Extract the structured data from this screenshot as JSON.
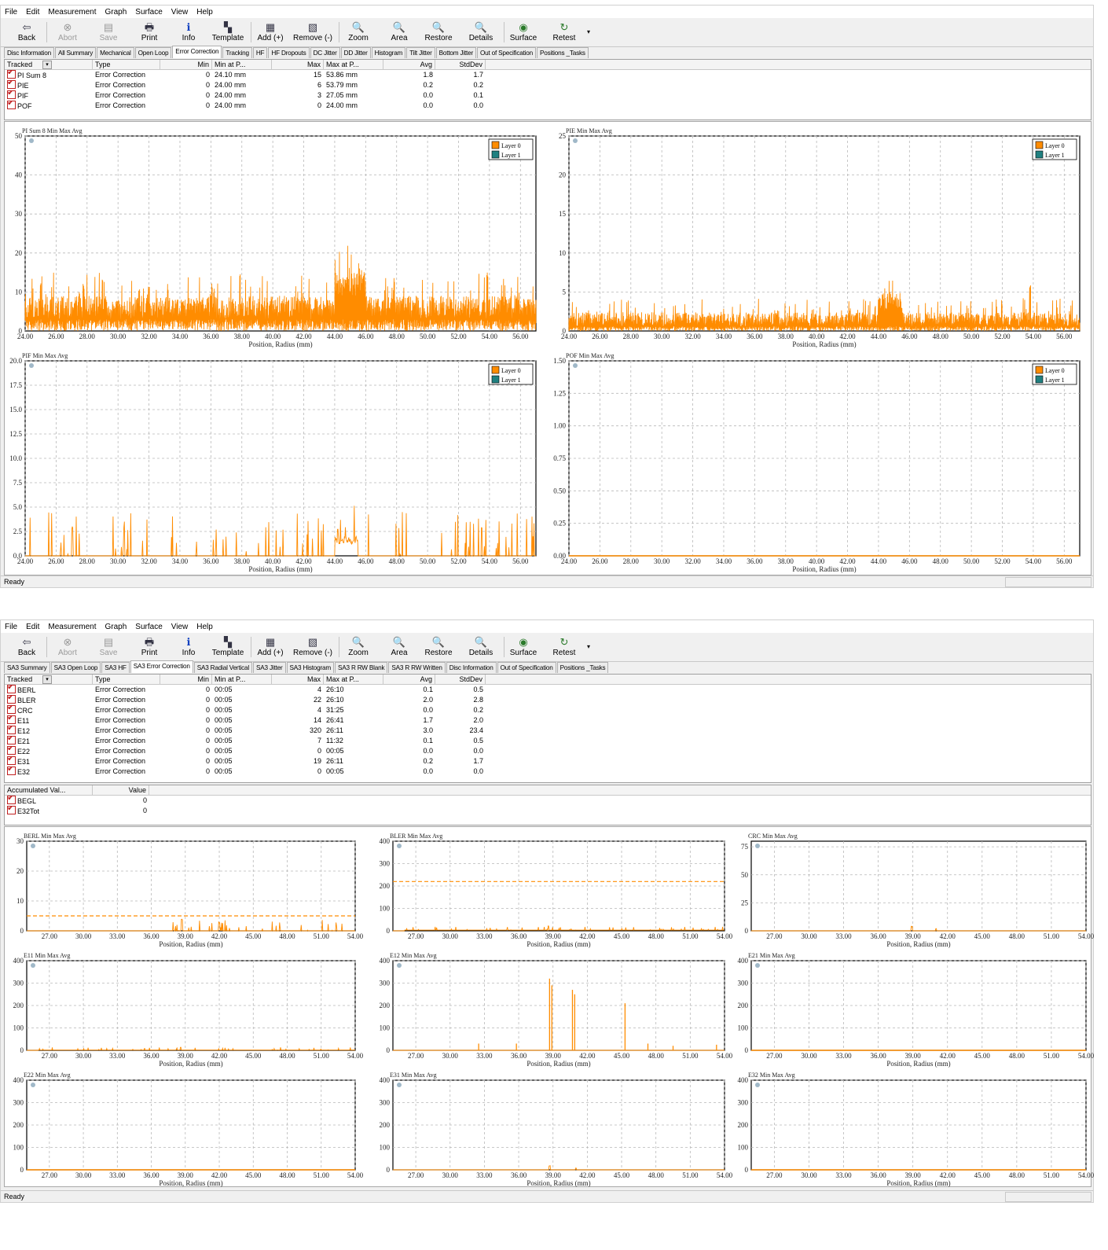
{
  "colors": {
    "layer0": "#ff8c00",
    "layer1": "#208080",
    "grid": "#b8b8b8",
    "red": "#c02020"
  },
  "windows": [
    {
      "menu": [
        "File",
        "Edit",
        "Measurement",
        "Graph",
        "Surface",
        "View",
        "Help"
      ],
      "toolbar": [
        {
          "label": "Back",
          "icon": "back-icon",
          "glyph": "⇦",
          "disabled": false
        },
        {
          "label": "Abort",
          "icon": "abort-icon",
          "glyph": "⊗",
          "disabled": true
        },
        {
          "label": "Save",
          "icon": "save-icon",
          "glyph": "▤",
          "disabled": true
        },
        {
          "label": "Print",
          "icon": "print-icon",
          "glyph": "🖶",
          "disabled": false
        },
        {
          "label": "Info",
          "icon": "info-icon",
          "glyph": "ℹ",
          "disabled": false
        },
        {
          "label": "Template",
          "icon": "template-icon",
          "glyph": "▚",
          "disabled": false
        },
        {
          "label": "Add (+)",
          "icon": "add-icon",
          "glyph": "▦",
          "disabled": false
        },
        {
          "label": "Remove (-)",
          "icon": "remove-icon",
          "glyph": "▧",
          "disabled": false
        },
        {
          "label": "Zoom",
          "icon": "zoom-icon",
          "glyph": "🔍",
          "disabled": false
        },
        {
          "label": "Area",
          "icon": "area-icon",
          "glyph": "🔍",
          "disabled": false
        },
        {
          "label": "Restore",
          "icon": "restore-icon",
          "glyph": "🔍",
          "disabled": false
        },
        {
          "label": "Details",
          "icon": "details-icon",
          "glyph": "🔍",
          "disabled": false
        },
        {
          "label": "Surface",
          "icon": "surface-icon",
          "glyph": "◉",
          "disabled": false
        },
        {
          "label": "Retest",
          "icon": "retest-icon",
          "glyph": "↻",
          "disabled": false
        }
      ],
      "tabs": [
        "Disc Information",
        "All Summary",
        "Mechanical",
        "Open Loop",
        "Error Correction",
        "Tracking",
        "HF",
        "HF Dropouts",
        "DC Jitter",
        "DD Jitter",
        "Histogram",
        "Tilt Jitter",
        "Bottom Jitter",
        "Out of Specification",
        "Positions _Tasks"
      ],
      "active_tab": "Error Correction",
      "table": {
        "headers": [
          "Tracked",
          "Type",
          "Min",
          "Min at P...",
          "Max",
          "Max at P...",
          "Avg",
          "StdDev"
        ],
        "rows": [
          [
            "PI Sum 8",
            "Error Correction",
            "0",
            "24.10 mm",
            "15",
            "53.86 mm",
            "1.8",
            "1.7"
          ],
          [
            "PIE",
            "Error Correction",
            "0",
            "24.00 mm",
            "6",
            "53.79 mm",
            "0.2",
            "0.2"
          ],
          [
            "PIF",
            "Error Correction",
            "0",
            "24.00 mm",
            "3",
            "27.05 mm",
            "0.0",
            "0.1"
          ],
          [
            "POF",
            "Error Correction",
            "0",
            "24.00 mm",
            "0",
            "24.00 mm",
            "0.0",
            "0.0"
          ]
        ]
      },
      "status": "Ready"
    },
    {
      "menu": [
        "File",
        "Edit",
        "Measurement",
        "Graph",
        "Surface",
        "View",
        "Help"
      ],
      "toolbar": [
        {
          "label": "Back",
          "icon": "back-icon",
          "glyph": "⇦",
          "disabled": false
        },
        {
          "label": "Abort",
          "icon": "abort-icon",
          "glyph": "⊗",
          "disabled": true
        },
        {
          "label": "Save",
          "icon": "save-icon",
          "glyph": "▤",
          "disabled": true
        },
        {
          "label": "Print",
          "icon": "print-icon",
          "glyph": "🖶",
          "disabled": false
        },
        {
          "label": "Info",
          "icon": "info-icon",
          "glyph": "ℹ",
          "disabled": false
        },
        {
          "label": "Template",
          "icon": "template-icon",
          "glyph": "▚",
          "disabled": false
        },
        {
          "label": "Add (+)",
          "icon": "add-icon",
          "glyph": "▦",
          "disabled": false
        },
        {
          "label": "Remove (-)",
          "icon": "remove-icon",
          "glyph": "▧",
          "disabled": false
        },
        {
          "label": "Zoom",
          "icon": "zoom-icon",
          "glyph": "🔍",
          "disabled": false
        },
        {
          "label": "Area",
          "icon": "area-icon",
          "glyph": "🔍",
          "disabled": false
        },
        {
          "label": "Restore",
          "icon": "restore-icon",
          "glyph": "🔍",
          "disabled": false
        },
        {
          "label": "Details",
          "icon": "details-icon",
          "glyph": "🔍",
          "disabled": false
        },
        {
          "label": "Surface",
          "icon": "surface-icon",
          "glyph": "◉",
          "disabled": false
        },
        {
          "label": "Retest",
          "icon": "retest-icon",
          "glyph": "↻",
          "disabled": false
        }
      ],
      "tabs": [
        "SA3 Summary",
        "SA3 Open Loop",
        "SA3 HF",
        "SA3 Error Correction",
        "SA3 Radial Vertical",
        "SA3 Jitter",
        "SA3 Histogram",
        "SA3 R RW Blank",
        "SA3 R RW Written",
        "Disc Information",
        "Out of Specification",
        "Positions _Tasks"
      ],
      "active_tab": "SA3 Error Correction",
      "table": {
        "headers": [
          "Tracked",
          "Type",
          "Min",
          "Min at P...",
          "Max",
          "Max at P...",
          "Avg",
          "StdDev"
        ],
        "rows": [
          [
            "BERL",
            "Error Correction",
            "0",
            "00:05",
            "4",
            "26:10",
            "0.1",
            "0.5"
          ],
          [
            "BLER",
            "Error Correction",
            "0",
            "00:05",
            "22",
            "26:10",
            "2.0",
            "2.8"
          ],
          [
            "CRC",
            "Error Correction",
            "0",
            "00:05",
            "4",
            "31:25",
            "0.0",
            "0.2"
          ],
          [
            "E11",
            "Error Correction",
            "0",
            "00:05",
            "14",
            "26:41",
            "1.7",
            "2.0"
          ],
          [
            "E12",
            "Error Correction",
            "0",
            "00:05",
            "320",
            "26:11",
            "3.0",
            "23.4"
          ],
          [
            "E21",
            "Error Correction",
            "0",
            "00:05",
            "7",
            "11:32",
            "0.1",
            "0.5"
          ],
          [
            "E22",
            "Error Correction",
            "0",
            "00:05",
            "0",
            "00:05",
            "0.0",
            "0.0"
          ],
          [
            "E31",
            "Error Correction",
            "0",
            "00:05",
            "19",
            "26:11",
            "0.2",
            "1.7"
          ],
          [
            "E32",
            "Error Correction",
            "0",
            "00:05",
            "0",
            "00:05",
            "0.0",
            "0.0"
          ]
        ]
      },
      "accum": {
        "headers": [
          "Accumulated Val...",
          "Value"
        ],
        "rows": [
          [
            "BEGL",
            "0"
          ],
          [
            "E32Tot",
            "0"
          ]
        ]
      },
      "status": "Ready"
    }
  ],
  "chart_data": [
    {
      "type": "line",
      "title": "PI Sum 8 Min Max Avg",
      "xlabel": "Position, Radius (mm)",
      "xlim": [
        24,
        57
      ],
      "ylim": [
        0,
        50
      ],
      "xticks": [
        "24.00",
        "26.00",
        "28.00",
        "30.00",
        "32.00",
        "34.00",
        "36.00",
        "38.00",
        "40.00",
        "42.00",
        "44.00",
        "46.00",
        "48.00",
        "50.00",
        "52.00",
        "54.00",
        "56.00"
      ],
      "yticks": [
        "0",
        "10",
        "20",
        "30",
        "40",
        "50"
      ],
      "legend": [
        "Layer 0",
        "Layer 1"
      ],
      "legend_position": "top-right",
      "series": [
        {
          "name": "Layer 0",
          "base": 3,
          "noise": 6,
          "peaks": [
            [
              25,
              13
            ],
            [
              27.5,
              10
            ],
            [
              29,
              14
            ],
            [
              32,
              12
            ],
            [
              36,
              10
            ],
            [
              38.5,
              9
            ],
            [
              45,
              11
            ],
            [
              53.86,
              15
            ]
          ],
          "bump": [
            44,
            46,
            8
          ]
        }
      ]
    },
    {
      "type": "line",
      "title": "PIE Min Max Avg",
      "xlabel": "Position, Radius (mm)",
      "xlim": [
        24,
        57
      ],
      "ylim": [
        0,
        25
      ],
      "xticks": [
        "24.00",
        "26.00",
        "28.00",
        "30.00",
        "32.00",
        "34.00",
        "36.00",
        "38.00",
        "40.00",
        "42.00",
        "44.00",
        "46.00",
        "48.00",
        "50.00",
        "52.00",
        "54.00",
        "56.00"
      ],
      "yticks": [
        "0",
        "5",
        "10",
        "15",
        "20",
        "25"
      ],
      "legend": [
        "Layer 0",
        "Layer 1"
      ],
      "legend_position": "top-right",
      "series": [
        {
          "name": "Layer 0",
          "base": 0.6,
          "noise": 1.8,
          "peaks": [
            [
              53.79,
              6
            ],
            [
              44.5,
              3
            ],
            [
              45.5,
              3
            ]
          ],
          "bump": [
            44,
            45.5,
            3
          ]
        }
      ]
    },
    {
      "type": "line",
      "title": "PIF Min Max Avg",
      "xlabel": "Position, Radius (mm)",
      "xlim": [
        24,
        57
      ],
      "ylim": [
        0,
        20
      ],
      "xticks": [
        "24.00",
        "26.00",
        "28.00",
        "30.00",
        "32.00",
        "34.00",
        "36.00",
        "38.00",
        "40.00",
        "42.00",
        "44.00",
        "46.00",
        "48.00",
        "50.00",
        "52.00",
        "54.00",
        "56.00"
      ],
      "yticks": [
        "0.0",
        "2.5",
        "5.0",
        "7.5",
        "10.0",
        "12.5",
        "15.0",
        "17.5",
        "20.0"
      ],
      "legend": [
        "Layer 0",
        "Layer 1"
      ],
      "legend_position": "top-right",
      "series": [
        {
          "name": "Layer 0",
          "base": 0,
          "noise": 0,
          "spikes": 1.8,
          "peaks": [
            [
              27.05,
              3
            ],
            [
              53.5,
              3
            ],
            [
              44.2,
              3
            ]
          ],
          "bump": [
            44,
            45.5,
            2
          ]
        }
      ]
    },
    {
      "type": "line",
      "title": "POF Min Max Avg",
      "xlabel": "Position, Radius (mm)",
      "xlim": [
        24,
        57
      ],
      "ylim": [
        0,
        1.5
      ],
      "xticks": [
        "24.00",
        "26.00",
        "28.00",
        "30.00",
        "32.00",
        "34.00",
        "36.00",
        "38.00",
        "40.00",
        "42.00",
        "44.00",
        "46.00",
        "48.00",
        "50.00",
        "52.00",
        "54.00",
        "56.00"
      ],
      "yticks": [
        "0.00",
        "0.25",
        "0.50",
        "0.75",
        "1.00",
        "1.25",
        "1.50"
      ],
      "legend": [
        "Layer 0",
        "Layer 1"
      ],
      "legend_position": "top-right",
      "series": [
        {
          "name": "Layer 0",
          "flat": 0
        }
      ]
    },
    {
      "type": "line",
      "title": "BERL Min Max Avg",
      "xlabel": "Position, Radius (mm)",
      "xlim": [
        25,
        54
      ],
      "ylim": [
        0,
        30
      ],
      "xticks": [
        "27.00",
        "30.00",
        "33.00",
        "36.00",
        "39.00",
        "42.00",
        "45.00",
        "48.00",
        "51.00",
        "54.00"
      ],
      "yticks": [
        "0",
        "10",
        "20",
        "30"
      ],
      "limit": 5,
      "series": [
        {
          "base": 0,
          "spikes": 1.5,
          "peaks": [
            [
              38.7,
              4
            ],
            [
              42,
              3
            ]
          ],
          "start": 37
        }
      ]
    },
    {
      "type": "line",
      "title": "BLER Min Max Avg",
      "xlabel": "Position, Radius (mm)",
      "xlim": [
        25,
        54
      ],
      "ylim": [
        0,
        400
      ],
      "xticks": [
        "27.00",
        "30.00",
        "33.00",
        "36.00",
        "39.00",
        "42.00",
        "45.00",
        "48.00",
        "51.00",
        "54.00"
      ],
      "yticks": [
        "0",
        "100",
        "200",
        "300",
        "400"
      ],
      "limit": 220,
      "series": [
        {
          "base": 3,
          "spikes": 6,
          "peaks": [
            [
              38.6,
              22
            ]
          ],
          "start": 26
        }
      ]
    },
    {
      "type": "line",
      "title": "CRC Min Max Avg",
      "xlabel": "Position, Radius (mm)",
      "xlim": [
        25,
        54
      ],
      "ylim": [
        0,
        80
      ],
      "xticks": [
        "27.00",
        "30.00",
        "33.00",
        "36.00",
        "39.00",
        "42.00",
        "45.00",
        "48.00",
        "51.00",
        "54.00"
      ],
      "yticks": [
        "0",
        "25",
        "50",
        "75"
      ],
      "series": [
        {
          "base": 0,
          "spikes": 0,
          "peaks": [
            [
              38.9,
              4
            ],
            [
              41,
              2
            ]
          ]
        }
      ]
    },
    {
      "type": "line",
      "title": "E11 Min Max Avg",
      "xlabel": "Position, Radius (mm)",
      "xlim": [
        25,
        54
      ],
      "ylim": [
        0,
        400
      ],
      "xticks": [
        "27.00",
        "30.00",
        "33.00",
        "36.00",
        "39.00",
        "42.00",
        "45.00",
        "48.00",
        "51.00",
        "54.00"
      ],
      "yticks": [
        "0",
        "100",
        "200",
        "300",
        "400"
      ],
      "series": [
        {
          "base": 1,
          "spikes": 5,
          "peaks": [
            [
              38.6,
              14
            ]
          ],
          "start": 26
        }
      ]
    },
    {
      "type": "line",
      "title": "E12 Min Max Avg",
      "xlabel": "Position, Radius (mm)",
      "xlim": [
        25,
        54
      ],
      "ylim": [
        0,
        400
      ],
      "xticks": [
        "27.00",
        "30.00",
        "33.00",
        "36.00",
        "39.00",
        "42.00",
        "45.00",
        "48.00",
        "51.00",
        "54.00"
      ],
      "yticks": [
        "0",
        "100",
        "200",
        "300",
        "400"
      ],
      "series": [
        {
          "base": 0,
          "spikes": 0,
          "tall": [
            [
              38.7,
              320
            ],
            [
              38.9,
              290
            ],
            [
              40.7,
              270
            ],
            [
              40.9,
              250
            ],
            [
              45.3,
              210
            ],
            [
              32.5,
              30
            ],
            [
              35.8,
              30
            ],
            [
              47.3,
              30
            ],
            [
              49.5,
              20
            ],
            [
              53.3,
              25
            ]
          ]
        }
      ]
    },
    {
      "type": "line",
      "title": "E21 Min Max Avg",
      "xlabel": "Position, Radius (mm)",
      "xlim": [
        25,
        54
      ],
      "ylim": [
        0,
        400
      ],
      "xticks": [
        "27.00",
        "30.00",
        "33.00",
        "36.00",
        "39.00",
        "42.00",
        "45.00",
        "48.00",
        "51.00",
        "54.00"
      ],
      "yticks": [
        "0",
        "100",
        "200",
        "300",
        "400"
      ],
      "series": [
        {
          "flat": 0
        }
      ]
    },
    {
      "type": "line",
      "title": "E22 Min Max Avg",
      "xlabel": "Position, Radius (mm)",
      "xlim": [
        25,
        54
      ],
      "ylim": [
        0,
        400
      ],
      "xticks": [
        "27.00",
        "30.00",
        "33.00",
        "36.00",
        "39.00",
        "42.00",
        "45.00",
        "48.00",
        "51.00",
        "54.00"
      ],
      "yticks": [
        "0",
        "100",
        "200",
        "300",
        "400"
      ],
      "series": [
        {
          "flat": 0
        }
      ]
    },
    {
      "type": "line",
      "title": "E31 Min Max Avg",
      "xlabel": "Position, Radius (mm)",
      "xlim": [
        25,
        54
      ],
      "ylim": [
        0,
        400
      ],
      "xticks": [
        "27.00",
        "30.00",
        "33.00",
        "36.00",
        "39.00",
        "42.00",
        "45.00",
        "48.00",
        "51.00",
        "54.00"
      ],
      "yticks": [
        "0",
        "100",
        "200",
        "300",
        "400"
      ],
      "series": [
        {
          "base": 0,
          "spikes": 0,
          "peaks": [
            [
              38.7,
              19
            ],
            [
              41,
              8
            ]
          ]
        }
      ]
    },
    {
      "type": "line",
      "title": "E32 Min Max Avg",
      "xlabel": "Position, Radius (mm)",
      "xlim": [
        25,
        54
      ],
      "ylim": [
        0,
        400
      ],
      "xticks": [
        "27.00",
        "30.00",
        "33.00",
        "36.00",
        "39.00",
        "42.00",
        "45.00",
        "48.00",
        "51.00",
        "54.00"
      ],
      "yticks": [
        "0",
        "100",
        "200",
        "300",
        "400"
      ],
      "series": [
        {
          "flat": 0
        }
      ]
    }
  ]
}
